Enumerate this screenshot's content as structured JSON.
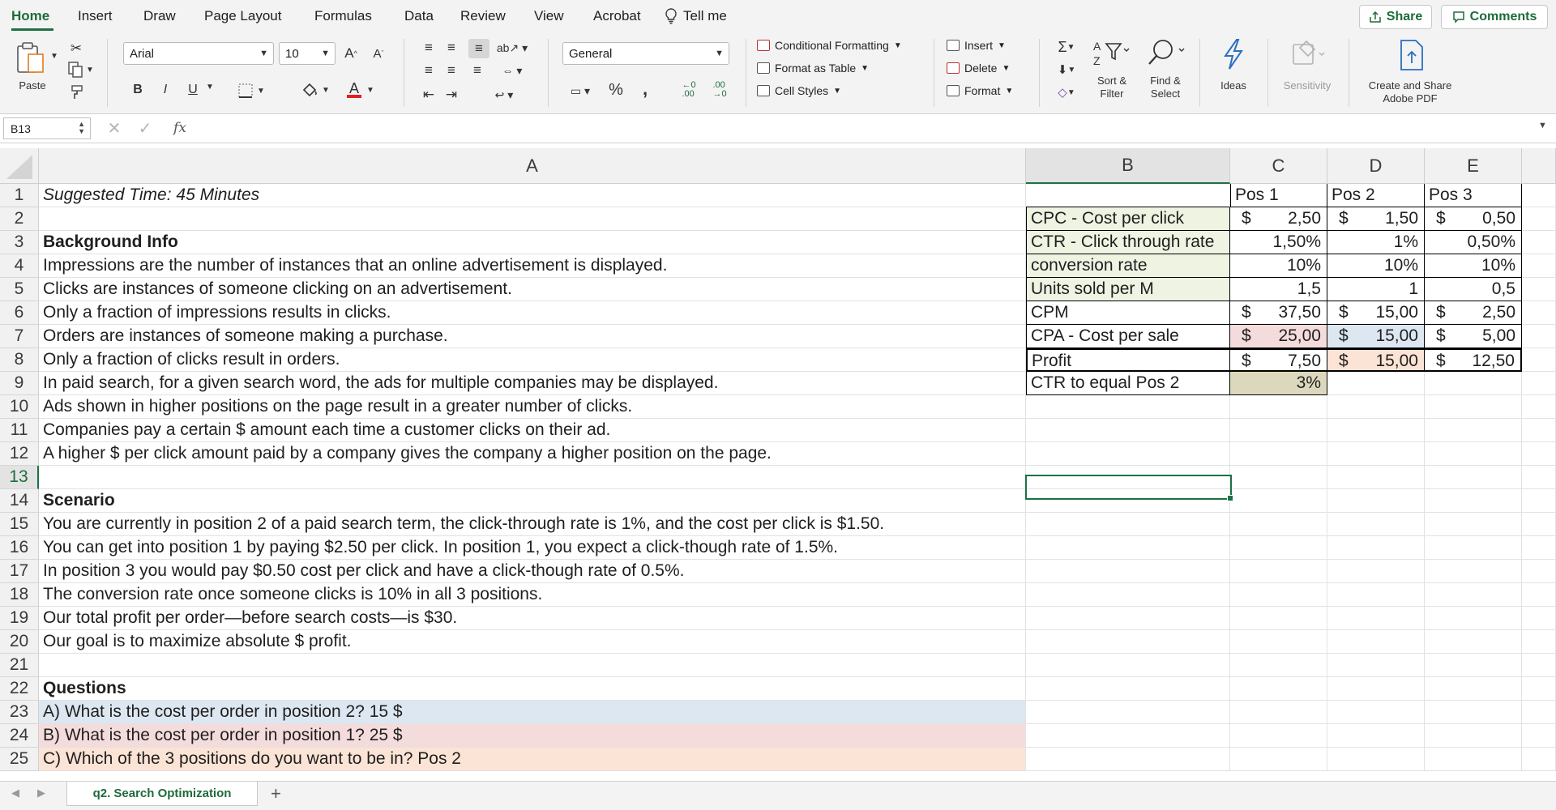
{
  "tabs": [
    "Home",
    "Insert",
    "Draw",
    "Page Layout",
    "Formulas",
    "Data",
    "Review",
    "View",
    "Acrobat"
  ],
  "tell_me": "Tell me",
  "share_label": "Share",
  "comments_label": "Comments",
  "ribbon": {
    "paste_label": "Paste",
    "font_name": "Arial",
    "font_size": "10",
    "number_format": "General",
    "conditional_formatting": "Conditional Formatting",
    "format_as_table": "Format as Table",
    "cell_styles": "Cell Styles",
    "insert": "Insert",
    "delete": "Delete",
    "format": "Format",
    "sort_filter": [
      "Sort &",
      "Filter"
    ],
    "find_select": [
      "Find &",
      "Select"
    ],
    "ideas": "Ideas",
    "sensitivity": "Sensitivity",
    "adobe": [
      "Create and Share",
      "Adobe PDF"
    ],
    "bold": "B",
    "italic": "I",
    "underline": "U",
    "percent": "%"
  },
  "formula_bar": {
    "name_box": "B13",
    "fx": "fx",
    "content": ""
  },
  "columns": [
    "A",
    "B",
    "C",
    "D",
    "E"
  ],
  "rows": [
    "1",
    "2",
    "3",
    "4",
    "5",
    "6",
    "7",
    "8",
    "9",
    "10",
    "11",
    "12",
    "13",
    "14",
    "15",
    "16",
    "17",
    "18",
    "19",
    "20",
    "21",
    "22",
    "23",
    "24",
    "25"
  ],
  "colA": [
    "Suggested Time:  45 Minutes",
    "",
    "Background Info",
    "Impressions are the number of instances that an online advertisement is displayed.",
    "Clicks are instances of someone clicking on an advertisement.",
    "Only a fraction of impressions results in clicks.",
    "Orders are instances of someone making a purchase.",
    "Only a fraction of clicks result in orders.",
    "In paid search, for a given search word, the ads for multiple companies may be displayed.",
    "Ads shown in higher positions on the page result in a greater number of clicks.",
    "Companies pay a certain $ amount each time a customer clicks on their ad.",
    "A higher $ per click amount paid by a company gives the company a higher position on the page.",
    "",
    "Scenario",
    "You are currently in position 2 of a paid search term, the click-through rate is 1%, and the cost per click is $1.50.",
    "You can get into position 1 by paying $2.50 per click. In position 1, you expect a click-though rate of 1.5%.",
    "In position 3 you would pay $0.50 cost per click and have a click-though rate of 0.5%.",
    "The conversion rate once someone clicks is 10% in all 3 positions.",
    "Our total profit per order—before search costs—is $30.",
    "Our goal is to maximize absolute $ profit.",
    "",
    "Questions",
    "A) What is the cost per order in position 2? 15 $",
    "B) What is the cost per order in position 1? 25 $",
    "C) Which of the 3 positions do you want to be in? Pos 2"
  ],
  "table": {
    "headers": [
      "Pos 1",
      "Pos 2",
      "Pos 3"
    ],
    "rows": [
      {
        "label": "CPC - Cost per click",
        "currency": true,
        "values": [
          "2,50",
          "1,50",
          "0,50"
        ]
      },
      {
        "label": "CTR - Click through rate",
        "currency": false,
        "values": [
          "1,50%",
          "1%",
          "0,50%"
        ]
      },
      {
        "label": "conversion rate",
        "currency": false,
        "values": [
          "10%",
          "10%",
          "10%"
        ]
      },
      {
        "label": "Units sold per M",
        "currency": false,
        "values": [
          "1,5",
          "1",
          "0,5"
        ]
      },
      {
        "label": "CPM",
        "currency": true,
        "values": [
          "37,50",
          "15,00",
          "2,50"
        ]
      },
      {
        "label": "CPA - Cost per sale",
        "currency": true,
        "values": [
          "25,00",
          "15,00",
          "5,00"
        ]
      },
      {
        "label": "Profit",
        "currency": true,
        "values": [
          "7,50",
          "15,00",
          "12,50"
        ]
      },
      {
        "label": "CTR to equal Pos 2",
        "currency": false,
        "values": [
          "3%",
          "",
          ""
        ]
      }
    ]
  },
  "currency_symbol": "$",
  "sheet_tab": "q2. Search Optimization",
  "colors": {
    "accent": "#1e7145",
    "label_fill": "#eef3e2",
    "blue_fill": "#dde7f1",
    "pink_fill": "#f5dcdc",
    "peach_fill": "#fbe4d5",
    "khaki_fill": "#dcd8bd"
  }
}
